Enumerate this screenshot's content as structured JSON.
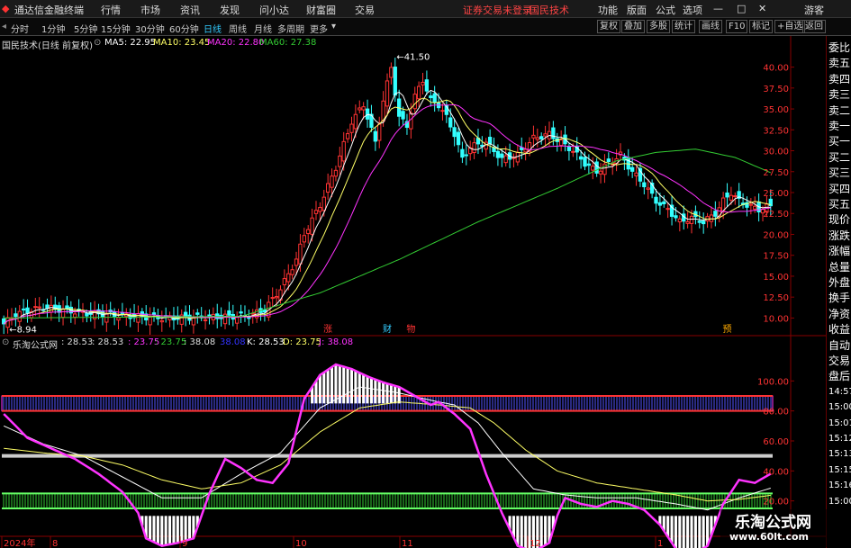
{
  "window": {
    "title": "通达信金融终端",
    "menus": [
      "行情",
      "市场",
      "资讯",
      "发现",
      "问小达",
      "财富圈",
      "交易"
    ],
    "status_login": "证券交易未登录",
    "status_stock": "国民技术",
    "right_menus": [
      "功能",
      "版面",
      "公式",
      "选项"
    ],
    "guest": "游客"
  },
  "toolbar": {
    "periods": [
      "分时",
      "1分钟",
      "5分钟",
      "15分钟",
      "30分钟",
      "60分钟",
      "日线",
      "周线",
      "月线",
      "多周期",
      "更多"
    ],
    "active": "日线",
    "buttons": [
      "复权",
      "叠加",
      "多股",
      "统计",
      "画线",
      "F10",
      "标记",
      "+自选",
      "返回"
    ]
  },
  "main_info": {
    "name": "国民技术(日线 前复权)",
    "ma5": "MA5: 22.95",
    "ma10": "MA10: 23.45",
    "ma20": "MA20: 22.80",
    "ma60": "MA60: 27.38"
  },
  "ind_info": {
    "name": "乐淘公式网",
    "v1": ": 28.53",
    "v2": ": 28.53",
    "v3": ": 23.75",
    "v4": ": 23.75",
    "v5": ": 38.08",
    "v6": "38.08",
    "k": "K: 28.53",
    "d": "D: 23.75",
    "j": "J: 38.08"
  },
  "right_panel": [
    "委比",
    "卖五",
    "卖四",
    "卖三",
    "卖二",
    "卖一",
    "买一",
    "买二",
    "买三",
    "买四",
    "买五",
    "现价",
    "涨跌",
    "涨幅",
    "总量",
    "外盘",
    "换手",
    "净资",
    "收益",
    "自动",
    "交易",
    "盘后",
    "14:57",
    "15:00",
    "15:01",
    "15:12",
    "15:13",
    "15:15",
    "15:16",
    "15:00"
  ],
  "markers": {
    "zhang": "涨",
    "cai": "财",
    "wu": "物",
    "yu": "预"
  },
  "max_label": "41.50",
  "min_label": "8.94",
  "watermark": {
    "line1": "乐淘公式网",
    "line2": "www.60lt.com"
  },
  "xaxis": [
    "2024年",
    "8",
    "9",
    "10",
    "11",
    "12",
    "1"
  ],
  "colors": {
    "up": "#ff3333",
    "down": "#33ffff",
    "ma5": "#ffffff",
    "ma10": "#ffff66",
    "ma20": "#ff33ff",
    "ma60": "#33cc33",
    "k": "#ffffff",
    "d": "#ffff66",
    "j": "#ff33ff"
  },
  "chart_data": [
    {
      "type": "candlestick",
      "title": "国民技术(日线 前复权)",
      "ylim": [
        8,
        42
      ],
      "yticks": [
        10.0,
        12.5,
        15.0,
        17.5,
        20.0,
        22.5,
        25.0,
        27.5,
        30.0,
        32.5,
        35.0,
        37.5,
        40.0
      ],
      "close_anchors": [
        [
          0,
          9.3
        ],
        [
          3,
          10.5
        ],
        [
          10,
          11.3
        ],
        [
          20,
          10.6
        ],
        [
          40,
          10.0
        ],
        [
          50,
          10.1
        ],
        [
          58,
          10.2
        ],
        [
          62,
          10.3
        ],
        [
          66,
          11.0
        ],
        [
          70,
          13.5
        ],
        [
          74,
          17.0
        ],
        [
          76,
          20.0
        ],
        [
          80,
          23.5
        ],
        [
          84,
          28.0
        ],
        [
          88,
          33.5
        ],
        [
          91,
          35.5
        ],
        [
          94,
          31.0
        ],
        [
          96,
          36.0
        ],
        [
          98,
          40.0
        ],
        [
          100,
          34.0
        ],
        [
          102,
          33.0
        ],
        [
          104,
          36.5
        ],
        [
          106,
          38.5
        ],
        [
          108,
          36.0
        ],
        [
          110,
          35.5
        ],
        [
          112,
          34.0
        ],
        [
          114,
          32.0
        ],
        [
          116,
          29.0
        ],
        [
          118,
          30.5
        ],
        [
          122,
          31.0
        ],
        [
          126,
          29.0
        ],
        [
          130,
          29.5
        ],
        [
          134,
          31.5
        ],
        [
          138,
          32.0
        ],
        [
          141,
          31.0
        ],
        [
          144,
          30.0
        ],
        [
          147,
          28.5
        ],
        [
          150,
          27.5
        ],
        [
          153,
          28.5
        ],
        [
          156,
          29.5
        ],
        [
          159,
          27.5
        ],
        [
          162,
          26.0
        ],
        [
          165,
          24.0
        ],
        [
          168,
          23.0
        ],
        [
          171,
          21.5
        ],
        [
          174,
          22.0
        ],
        [
          177,
          21.5
        ],
        [
          180,
          22.5
        ],
        [
          182,
          24.0
        ],
        [
          184,
          25.0
        ],
        [
          186,
          24.0
        ],
        [
          188,
          23.5
        ],
        [
          191,
          23.0
        ],
        [
          194,
          23.4
        ]
      ],
      "ma60_anchors": [
        [
          0,
          10.0
        ],
        [
          60,
          10.2
        ],
        [
          80,
          13.0
        ],
        [
          100,
          17.0
        ],
        [
          120,
          21.5
        ],
        [
          140,
          25.5
        ],
        [
          155,
          28.8
        ],
        [
          165,
          29.8
        ],
        [
          175,
          30.2
        ],
        [
          185,
          29.2
        ],
        [
          194,
          27.38
        ]
      ],
      "max_high": 41.5,
      "min_low": 8.94,
      "last_ma": {
        "MA5": 22.95,
        "MA10": 23.45,
        "MA20": 22.8,
        "MA60": 27.38
      }
    },
    {
      "type": "line",
      "title": "乐淘公式网",
      "ylim": [
        0,
        120
      ],
      "yticks": [
        20.0,
        40.0,
        60.0,
        80.0,
        100.0
      ],
      "bands": [
        80,
        20
      ],
      "midline": 50,
      "j_anchors": [
        [
          0,
          78
        ],
        [
          6,
          62
        ],
        [
          12,
          55
        ],
        [
          18,
          48
        ],
        [
          24,
          38
        ],
        [
          30,
          26
        ],
        [
          34,
          12
        ],
        [
          36,
          -5
        ],
        [
          40,
          -10
        ],
        [
          44,
          -8
        ],
        [
          48,
          -5
        ],
        [
          52,
          25
        ],
        [
          56,
          48
        ],
        [
          60,
          42
        ],
        [
          64,
          34
        ],
        [
          68,
          32
        ],
        [
          72,
          45
        ],
        [
          76,
          88
        ],
        [
          80,
          104
        ],
        [
          84,
          111
        ],
        [
          88,
          108
        ],
        [
          92,
          103
        ],
        [
          96,
          99
        ],
        [
          100,
          96
        ],
        [
          104,
          90
        ],
        [
          108,
          84
        ],
        [
          110,
          86
        ],
        [
          112,
          82
        ],
        [
          114,
          78
        ],
        [
          118,
          68
        ],
        [
          122,
          38
        ],
        [
          126,
          12
        ],
        [
          130,
          -10
        ],
        [
          134,
          -14
        ],
        [
          138,
          -8
        ],
        [
          140,
          10
        ],
        [
          142,
          22
        ],
        [
          146,
          18
        ],
        [
          150,
          16
        ],
        [
          154,
          20
        ],
        [
          158,
          18
        ],
        [
          162,
          14
        ],
        [
          166,
          4
        ],
        [
          170,
          -12
        ],
        [
          174,
          -16
        ],
        [
          178,
          -10
        ],
        [
          182,
          18
        ],
        [
          186,
          34
        ],
        [
          190,
          32
        ],
        [
          194,
          38.08
        ]
      ],
      "k_anchors": [
        [
          0,
          70
        ],
        [
          10,
          58
        ],
        [
          20,
          50
        ],
        [
          30,
          36
        ],
        [
          40,
          22
        ],
        [
          50,
          22
        ],
        [
          60,
          38
        ],
        [
          70,
          52
        ],
        [
          80,
          82
        ],
        [
          90,
          96
        ],
        [
          100,
          92
        ],
        [
          110,
          86
        ],
        [
          114,
          84
        ],
        [
          120,
          72
        ],
        [
          126,
          52
        ],
        [
          134,
          28
        ],
        [
          142,
          24
        ],
        [
          150,
          22
        ],
        [
          160,
          22
        ],
        [
          170,
          18
        ],
        [
          178,
          14
        ],
        [
          186,
          22
        ],
        [
          194,
          28.53
        ]
      ],
      "d_anchors": [
        [
          0,
          55
        ],
        [
          10,
          52
        ],
        [
          20,
          50
        ],
        [
          30,
          44
        ],
        [
          40,
          34
        ],
        [
          50,
          28
        ],
        [
          60,
          32
        ],
        [
          70,
          44
        ],
        [
          80,
          66
        ],
        [
          90,
          82
        ],
        [
          100,
          86
        ],
        [
          110,
          84
        ],
        [
          118,
          82
        ],
        [
          124,
          72
        ],
        [
          132,
          54
        ],
        [
          140,
          40
        ],
        [
          150,
          32
        ],
        [
          160,
          28
        ],
        [
          170,
          24
        ],
        [
          178,
          20
        ],
        [
          186,
          21
        ],
        [
          194,
          23.75
        ]
      ],
      "last": {
        "K": 28.53,
        "D": 23.75,
        "J": 38.08
      }
    }
  ]
}
